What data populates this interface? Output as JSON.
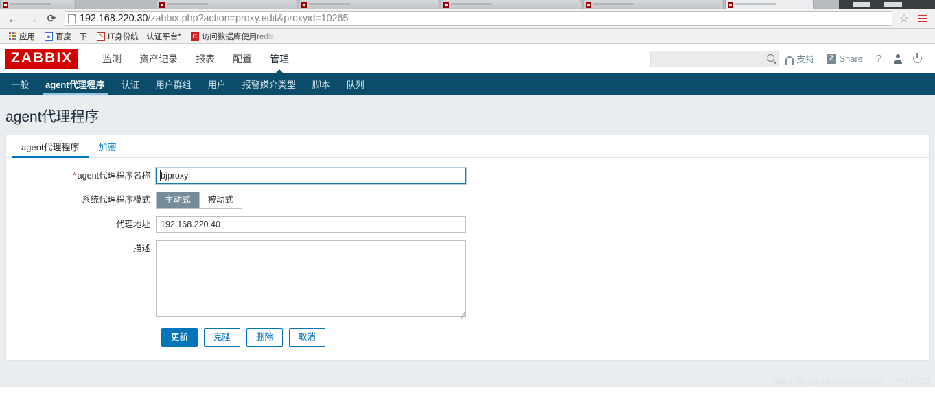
{
  "browser": {
    "back_icon": "back-arrow-icon",
    "forward_icon": "forward-arrow-icon",
    "reload_icon": "reload-icon",
    "url_host": "192.168.220.30",
    "url_path": "/zabbix.php?action=proxy.edit&proxyid=10265",
    "url_full": "192.168.220.30/zabbix.php?action=proxy.edit&proxyid=10265",
    "star_icon": "bookmark-star-icon",
    "menu_icon": "browser-menu-icon",
    "bookmarks": [
      {
        "label": "应用",
        "icon": "apps-grid-icon"
      },
      {
        "label": "百度一下",
        "icon": "baidu-icon"
      },
      {
        "label": "IT身份统一认证平台*",
        "icon": "it-auth-icon"
      },
      {
        "label": "访问数据库使用redis",
        "icon": "redis-doc-icon"
      }
    ]
  },
  "zabbix": {
    "logo": "ZABBIX",
    "main_nav": [
      {
        "label": "监测",
        "active": false
      },
      {
        "label": "资产记录",
        "active": false
      },
      {
        "label": "报表",
        "active": false
      },
      {
        "label": "配置",
        "active": false
      },
      {
        "label": "管理",
        "active": true
      }
    ],
    "search": {
      "value": "",
      "placeholder": ""
    },
    "support_label": "支持",
    "share_label": "Share",
    "share_badge": "Z",
    "help_label": "?",
    "sub_nav": [
      {
        "label": "一般",
        "active": false
      },
      {
        "label": "agent代理程序",
        "active": true
      },
      {
        "label": "认证",
        "active": false
      },
      {
        "label": "用户群组",
        "active": false
      },
      {
        "label": "用户",
        "active": false
      },
      {
        "label": "报警媒介类型",
        "active": false
      },
      {
        "label": "脚本",
        "active": false
      },
      {
        "label": "队列",
        "active": false
      }
    ]
  },
  "page": {
    "title": "agent代理程序",
    "tabs": [
      {
        "label": "agent代理程序",
        "active": true
      },
      {
        "label": "加密",
        "active": false
      }
    ]
  },
  "form": {
    "name": {
      "label": "agent代理程序名称",
      "required": true,
      "value": "bjproxy",
      "placeholder": ""
    },
    "mode": {
      "label": "系统代理程序模式",
      "options": [
        {
          "label": "主动式",
          "selected": true
        },
        {
          "label": "被动式",
          "selected": false
        }
      ]
    },
    "address": {
      "label": "代理地址",
      "value": "192.168.220.40",
      "placeholder": ""
    },
    "description": {
      "label": "描述",
      "value": "",
      "placeholder": ""
    },
    "buttons": [
      {
        "label": "更新",
        "primary": true
      },
      {
        "label": "克隆",
        "primary": false
      },
      {
        "label": "删除",
        "primary": false
      },
      {
        "label": "取消",
        "primary": false
      }
    ]
  },
  "watermark": "https://blog.csdn.net/weixin_44437026",
  "colors": {
    "brand_red": "#d40000",
    "nav_dark": "#0a4c69",
    "accent_blue": "#0275b8",
    "page_bg": "#e9edf0"
  }
}
